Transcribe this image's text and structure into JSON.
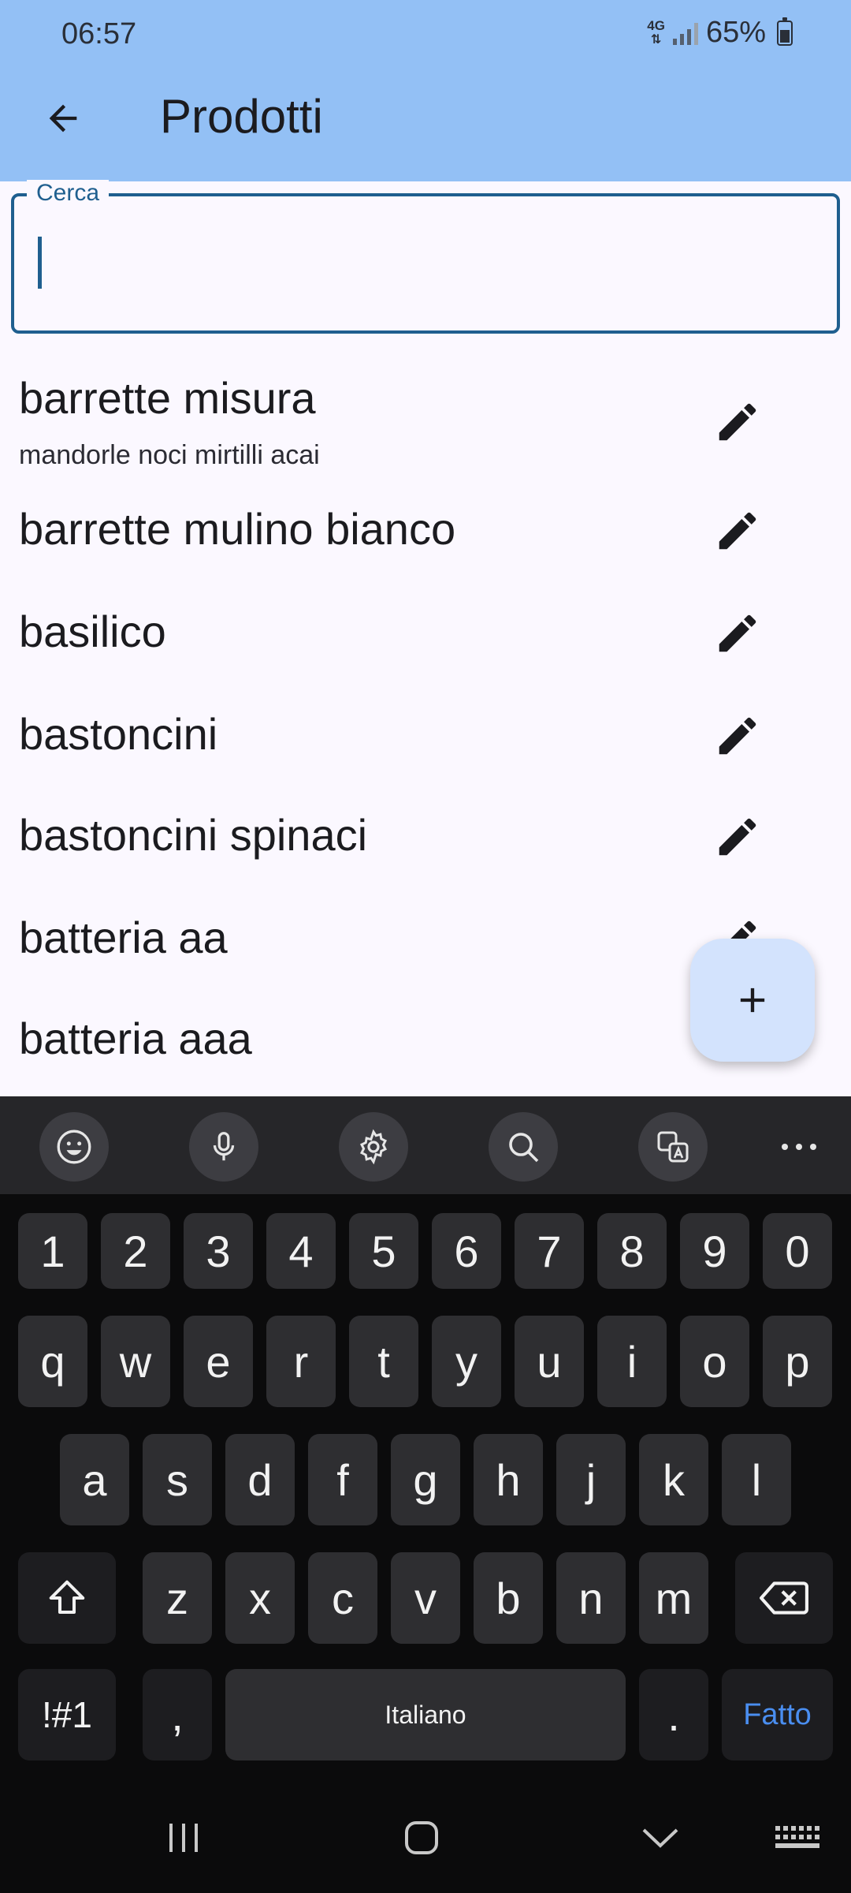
{
  "status_bar": {
    "time": "06:57",
    "network": "4G",
    "battery": "65%",
    "battery_level": 0.65
  },
  "app_bar": {
    "title": "Prodotti"
  },
  "search": {
    "label": "Cerca",
    "value": ""
  },
  "products": [
    {
      "name": "barrette misura",
      "description": "mandorle noci mirtilli acai"
    },
    {
      "name": "barrette mulino bianco",
      "description": ""
    },
    {
      "name": "basilico",
      "description": ""
    },
    {
      "name": "bastoncini",
      "description": ""
    },
    {
      "name": "bastoncini spinaci",
      "description": ""
    },
    {
      "name": "batteria aa",
      "description": ""
    },
    {
      "name": "batteria aaa",
      "description": ""
    }
  ],
  "keyboard": {
    "row_numbers": [
      "1",
      "2",
      "3",
      "4",
      "5",
      "6",
      "7",
      "8",
      "9",
      "0"
    ],
    "row_1": [
      "q",
      "w",
      "e",
      "r",
      "t",
      "y",
      "u",
      "i",
      "o",
      "p"
    ],
    "row_2": [
      "a",
      "s",
      "d",
      "f",
      "g",
      "h",
      "j",
      "k",
      "l"
    ],
    "row_3": [
      "z",
      "x",
      "c",
      "v",
      "b",
      "n",
      "m"
    ],
    "symbols_label": "!#1",
    "comma_label": ",",
    "space_label": "Italiano",
    "period_label": ".",
    "done_label": "Fatto"
  },
  "colors": {
    "app_bar": "#93c0f5",
    "accent": "#1f5f8f",
    "fab": "#d3e3fd",
    "keyboard_bg": "#0b0b0c",
    "key": "#2e2e31",
    "done": "#4a8ef0"
  }
}
